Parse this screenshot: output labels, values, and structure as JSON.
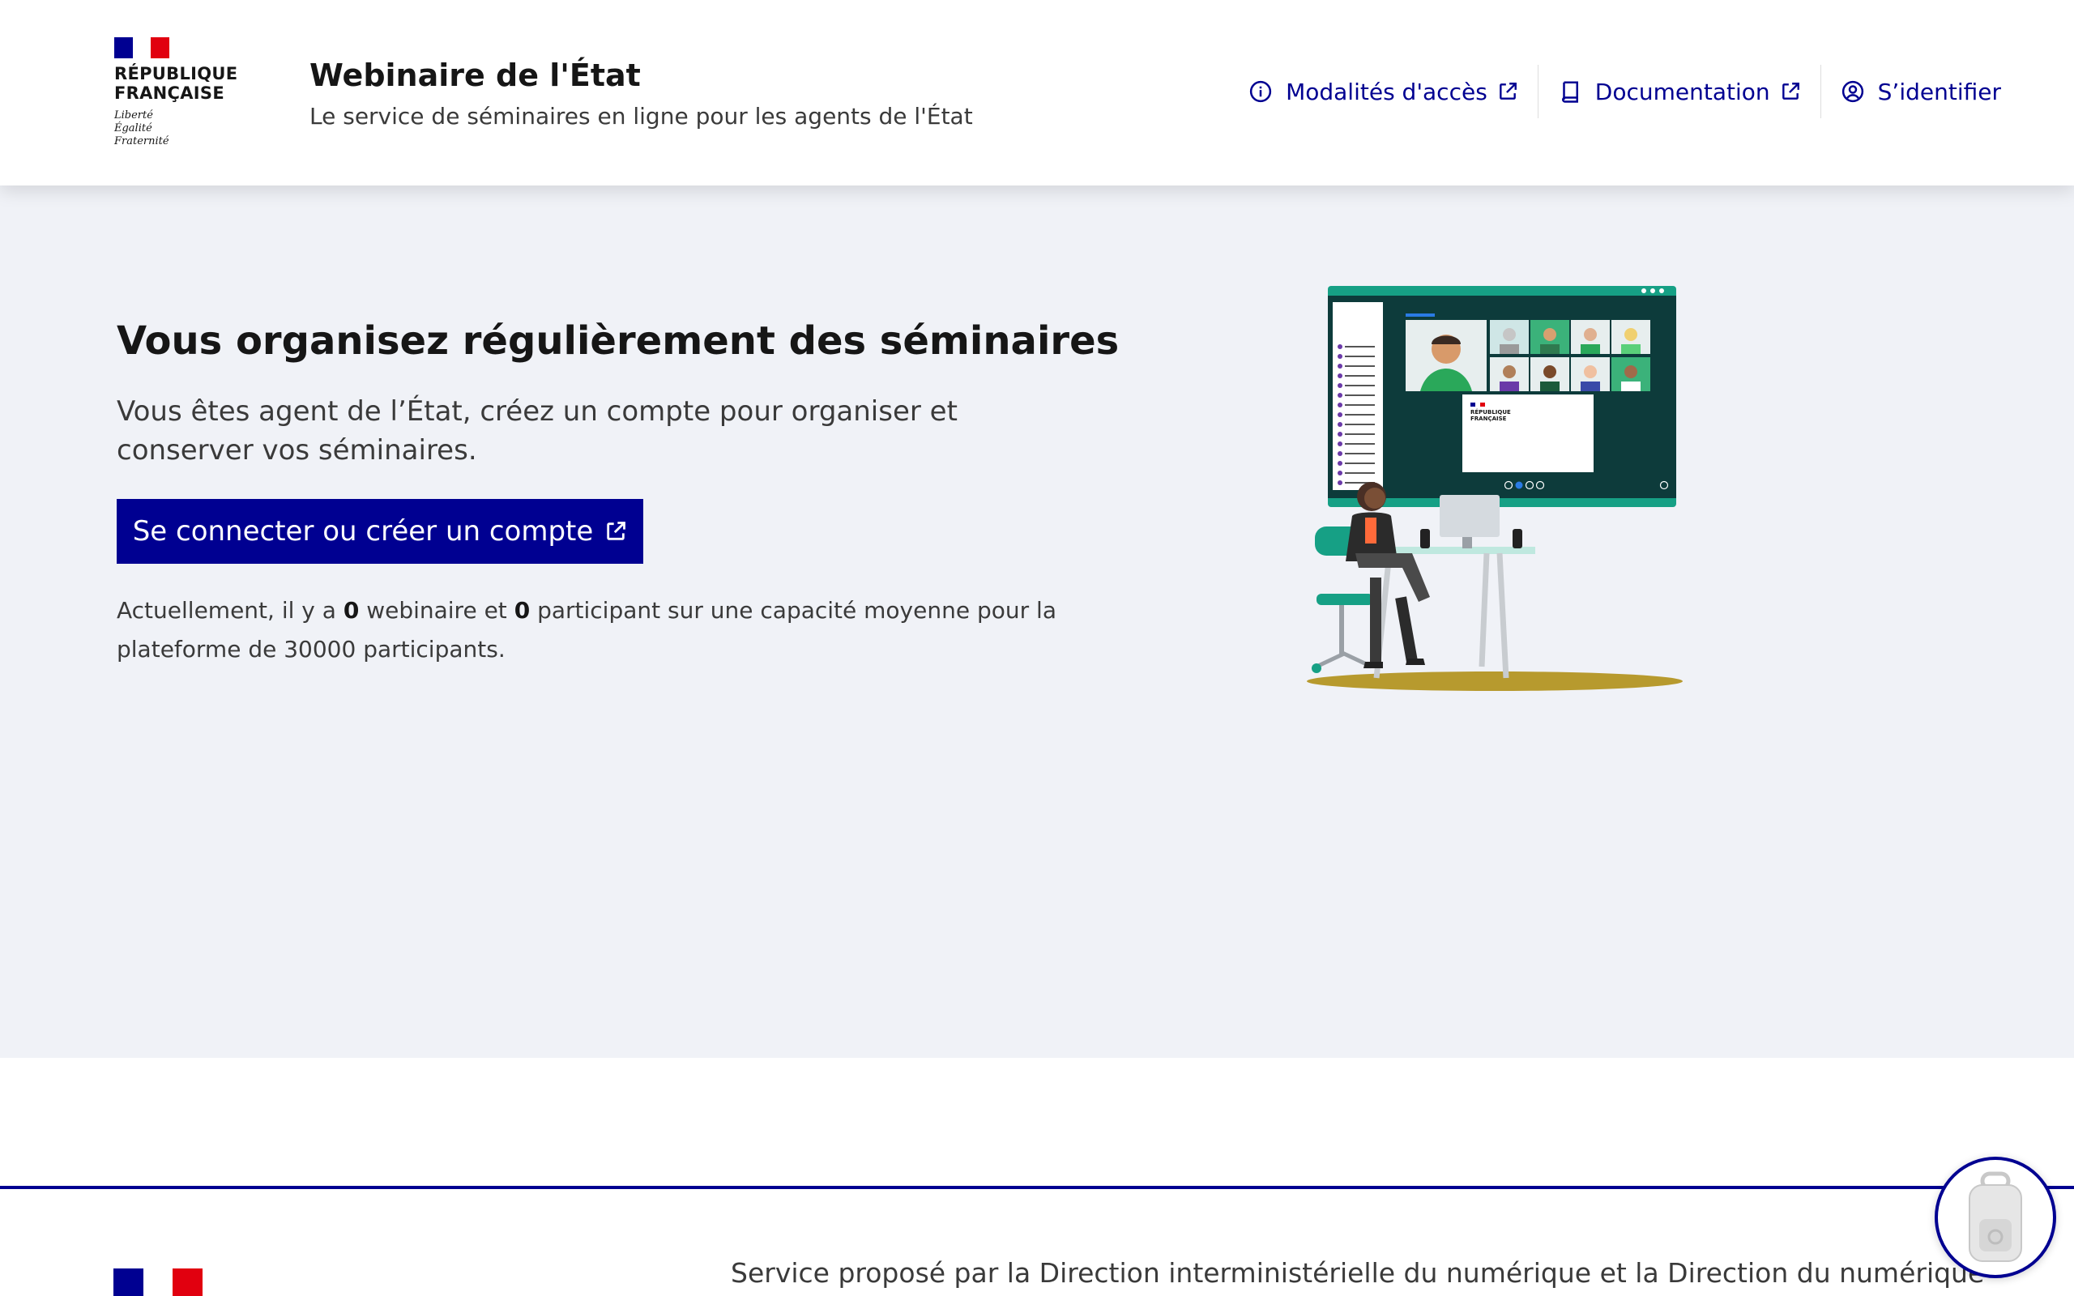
{
  "header": {
    "logo_line1": "RÉPUBLIQUE",
    "logo_line2": "FRANÇAISE",
    "motto": [
      "Liberté",
      "Égalité",
      "Fraternité"
    ],
    "service_title": "Webinaire de l'État",
    "service_tagline": "Le service de séminaires en ligne pour les agents de l'État",
    "tools": [
      {
        "label": "Modalités d'accès",
        "icon": "info-icon",
        "external": true
      },
      {
        "label": "Documentation",
        "icon": "book-icon",
        "external": true
      },
      {
        "label": "S’identifier",
        "icon": "user-icon",
        "external": false
      }
    ]
  },
  "main": {
    "title": "Vous organisez régulièrement des séminaires",
    "lead": "Vous êtes agent de l’État, créez un compte pour organiser et conserver vos séminaires.",
    "cta_label": "Se connecter ou créer un compte",
    "stats": {
      "before": "Actuellement, il y a ",
      "webinars": "0",
      "middle": " webinaire et ",
      "participants": "0",
      "after": " participant sur une capacité moyenne pour la plateforme de 30000 participants."
    },
    "illustration": {
      "screen_logo_line1": "RÉPUBLIQUE",
      "screen_logo_line2": "FRANÇAISE"
    }
  },
  "footer": {
    "text": "Service proposé par la Direction interministérielle du numérique et la Direction du numérique"
  },
  "colors": {
    "primary": "#000091",
    "background_alt": "#f0f2f7",
    "flag_blue": "#000091",
    "flag_red": "#e1000f",
    "illu_teal": "#16a085",
    "illu_dark": "#0d3b3b",
    "illu_floor": "#b79a2e"
  }
}
